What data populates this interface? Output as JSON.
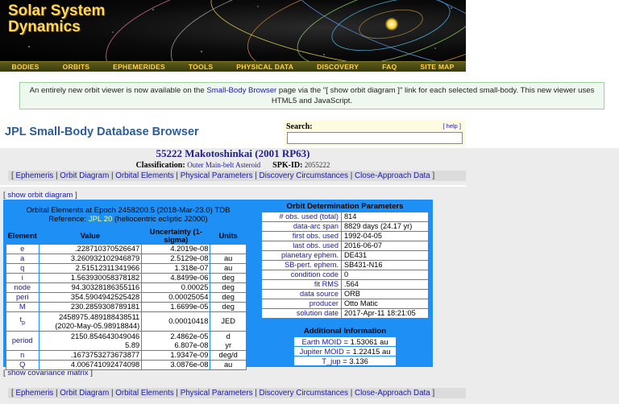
{
  "site": {
    "title_line1": "Solar System",
    "title_line2": "Dynamics",
    "nav": [
      "BODIES",
      "ORBITS",
      "EPHEMERIDES",
      "TOOLS",
      "PHYSICAL DATA",
      "DISCOVERY",
      "FAQ",
      "SITE MAP"
    ]
  },
  "notice": {
    "text_before": "An entirely new orbit viewer is now available on the ",
    "link": "Small-Body Browser",
    "text_after": " page via the \"[ show orbit diagram ]\" link for each selected small-body. This new viewer uses HTML5 and JavaScript."
  },
  "header": {
    "title": "JPL Small-Body Database Browser",
    "search_label": "Search:",
    "help_link": "[ help ]",
    "search_value": ""
  },
  "object": {
    "name": "55222 Makotoshinkai (2001 RP63)",
    "classification_label": "Classification:",
    "classification_value": "Outer Main-belt Asteroid",
    "spk_label": "SPK-ID:",
    "spk_value": "2055222"
  },
  "section_nav": {
    "open": "[ ",
    "close": " ]",
    "sep": " | ",
    "items": [
      "Ephemeris",
      "Orbit Diagram",
      "Orbital Elements",
      "Physical Parameters",
      "Discovery Circumstances",
      "Close-Approach Data"
    ]
  },
  "links": {
    "show_orbit_open": "[ ",
    "show_orbit": "show orbit diagram",
    "show_orbit_close": " ]",
    "show_cov_open": "[ ",
    "show_cov": "show covariance matrix",
    "show_cov_close": " ]"
  },
  "orbital_elements": {
    "caption_line1": "Orbital Elements at Epoch 2458200.5 (2018-Mar-23.0) TDB",
    "caption_ref_label": "Reference: ",
    "caption_ref": "JPL 20",
    "caption_ref_after": " (heliocentric ecliptic J2000)",
    "headers": [
      "Element",
      "Value",
      "Uncertainty (1-sigma)",
      "Units"
    ],
    "rows": [
      {
        "el": "e",
        "value": ".228710370526647",
        "unc": "4.2019e-08",
        "unit": ""
      },
      {
        "el": "a",
        "value": "3.260932102946879",
        "unc": "2.5129e-08",
        "unit": "au"
      },
      {
        "el": "q",
        "value": "2.51512311341966",
        "unc": "1.318e-07",
        "unit": "au"
      },
      {
        "el": "i",
        "value": "1.563930058378182",
        "unc": "4.8499e-06",
        "unit": "deg"
      },
      {
        "el": "node",
        "value": "94.30328186355116",
        "unc": "0.00025",
        "unit": "deg"
      },
      {
        "el": "peri",
        "value": "354.5904942525428",
        "unc": "0.00025054",
        "unit": "deg"
      },
      {
        "el": "M",
        "value": "230.2859308789181",
        "unc": "1.6699e-05",
        "unit": "deg"
      }
    ],
    "tp": {
      "el_main": "t",
      "el_sub": "p",
      "value1": "2458975.489188438511",
      "value2": "(2020-May-05.98918844)",
      "unc": "0.00010418",
      "unit": "JED"
    },
    "period": {
      "el": "period",
      "value1": "2150.854643049046",
      "value2": "5.89",
      "unc1": "2.4862e-05",
      "unc2": "6.807e-08",
      "unit1": "d",
      "unit2": "yr"
    },
    "rows_after": [
      {
        "el": "n",
        "value": ".1673753273673877",
        "unc": "1.9347e-09",
        "unit": "deg/d"
      },
      {
        "el": "Q",
        "value": "4.006741092474098",
        "unc": "3.0876e-08",
        "unit": "au"
      }
    ]
  },
  "orbit_determination": {
    "caption": "Orbit Determination Parameters",
    "rows": [
      {
        "label": "# obs. used (total)",
        "value": "814"
      },
      {
        "label": "data-arc span",
        "value": "8829 days (24.17 yr)"
      },
      {
        "label": "first obs. used",
        "value": "1992-04-05"
      },
      {
        "label": "last obs. used",
        "value": "2016-06-07"
      },
      {
        "label": "planetary ephem.",
        "value": "DE431"
      },
      {
        "label": "SB-pert. ephem.",
        "value": "SB431-N16"
      },
      {
        "label": "condition code",
        "value": "0"
      },
      {
        "label": "fit RMS",
        "value": ".564"
      },
      {
        "label": "data source",
        "value": "ORB"
      },
      {
        "label": "producer",
        "value": "Otto Matic"
      },
      {
        "label": "solution date",
        "value": "2017-Apr-11 18:21:05"
      }
    ]
  },
  "additional_info": {
    "caption": "Additional Information",
    "rows": [
      {
        "label": "Earth MOID",
        "value": " = 1.53061 au"
      },
      {
        "label": "Jupiter MOID",
        "value": " = 1.22415 au"
      },
      {
        "label": "T_jup",
        "value": " = 3.136"
      }
    ]
  }
}
